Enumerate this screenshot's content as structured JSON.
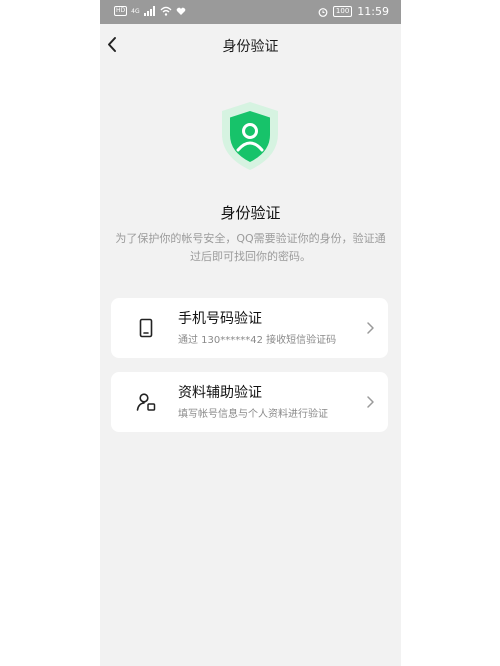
{
  "status_bar": {
    "network_tag": "HD",
    "signal_label": "4G",
    "battery": "100",
    "time": "11:59"
  },
  "nav": {
    "title": "身份验证",
    "back_icon": "chevron-left-icon"
  },
  "hero": {
    "icon": "shield-user-icon",
    "heading": "身份验证",
    "description": "为了保护你的帐号安全，QQ需要验证你的身份，验证通过后即可找回你的密码。"
  },
  "options": [
    {
      "icon": "phone-icon",
      "title": "手机号码验证",
      "subtitle": "通过 130******42 接收短信验证码"
    },
    {
      "icon": "user-info-icon",
      "title": "资料辅助验证",
      "subtitle": "填写帐号信息与个人资料进行验证"
    }
  ],
  "colors": {
    "accent_green": "#17c36a",
    "shield_halo": "#d6f3e1",
    "background": "#f2f2f2",
    "status_bar": "#9a9a9a"
  }
}
